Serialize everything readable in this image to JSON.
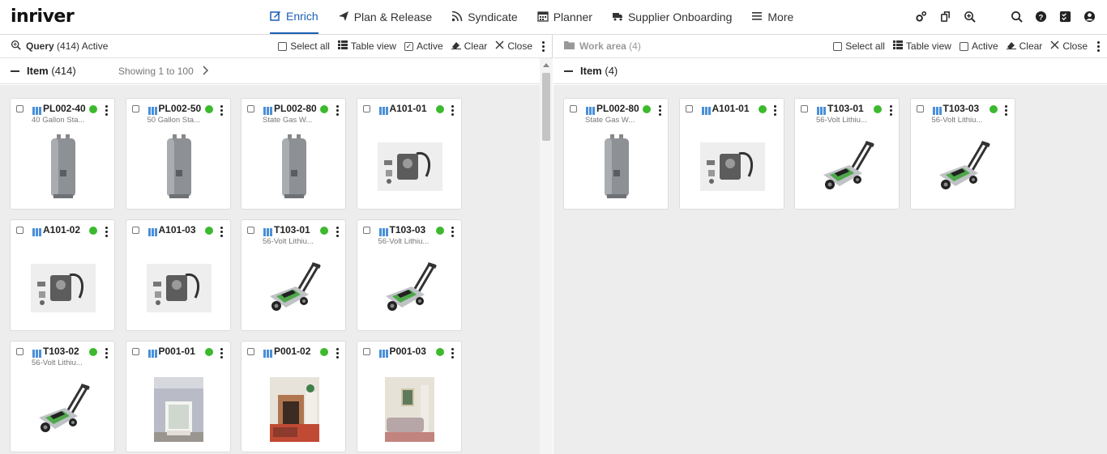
{
  "app": {
    "logo": "inriver"
  },
  "nav": [
    {
      "label": "Enrich",
      "icon": "edit-icon",
      "active": true
    },
    {
      "label": "Plan & Release",
      "icon": "paper-plane-icon",
      "active": false
    },
    {
      "label": "Syndicate",
      "icon": "rss-icon",
      "active": false
    },
    {
      "label": "Planner",
      "icon": "calendar-icon",
      "active": false
    },
    {
      "label": "Supplier Onboarding",
      "icon": "truck-icon",
      "active": false
    },
    {
      "label": "More",
      "icon": "hamburger-icon",
      "active": false
    }
  ],
  "left_toolbar": {
    "title": "Query",
    "count": "(414)",
    "status": "Active",
    "select_all": "Select all",
    "table_view": "Table view",
    "active": "Active",
    "clear": "Clear",
    "close": "Close"
  },
  "left_sub": {
    "title": "Item",
    "count": "(414)",
    "showing": "Showing 1 to 100"
  },
  "right_toolbar": {
    "title": "Work area",
    "count": "(4)",
    "select_all": "Select all",
    "table_view": "Table view",
    "active": "Active",
    "clear": "Clear",
    "close": "Close"
  },
  "right_sub": {
    "title": "Item",
    "count": "(4)"
  },
  "left_cards": [
    {
      "code": "PL002-40",
      "desc": "40 Gallon Sta...",
      "image": "water-heater"
    },
    {
      "code": "PL002-50",
      "desc": "50 Gallon Sta...",
      "image": "water-heater"
    },
    {
      "code": "PL002-80",
      "desc": "State Gas W...",
      "image": "water-heater"
    },
    {
      "code": "A101-01",
      "desc": "",
      "image": "parts-kit"
    },
    {
      "code": "A101-02",
      "desc": "",
      "image": "parts-kit"
    },
    {
      "code": "A101-03",
      "desc": "",
      "image": "parts-kit"
    },
    {
      "code": "T103-01",
      "desc": "56-Volt Lithiu...",
      "image": "lawn-mower"
    },
    {
      "code": "T103-03",
      "desc": "56-Volt Lithiu...",
      "image": "lawn-mower"
    },
    {
      "code": "T103-02",
      "desc": "56-Volt Lithiu...",
      "image": "lawn-mower"
    },
    {
      "code": "P001-01",
      "desc": "",
      "image": "room-window"
    },
    {
      "code": "P001-02",
      "desc": "",
      "image": "room-fireplace"
    },
    {
      "code": "P001-03",
      "desc": "",
      "image": "room-sofa"
    }
  ],
  "right_cards": [
    {
      "code": "PL002-80",
      "desc": "State Gas W...",
      "image": "water-heater"
    },
    {
      "code": "A101-01",
      "desc": "",
      "image": "parts-kit"
    },
    {
      "code": "T103-01",
      "desc": "56-Volt Lithiu...",
      "image": "lawn-mower"
    },
    {
      "code": "T103-03",
      "desc": "56-Volt Lithiu...",
      "image": "lawn-mower"
    }
  ],
  "colors": {
    "accent": "#1a5fb4",
    "status_dot": "#3cb92e",
    "grid_bg": "#ededed"
  }
}
